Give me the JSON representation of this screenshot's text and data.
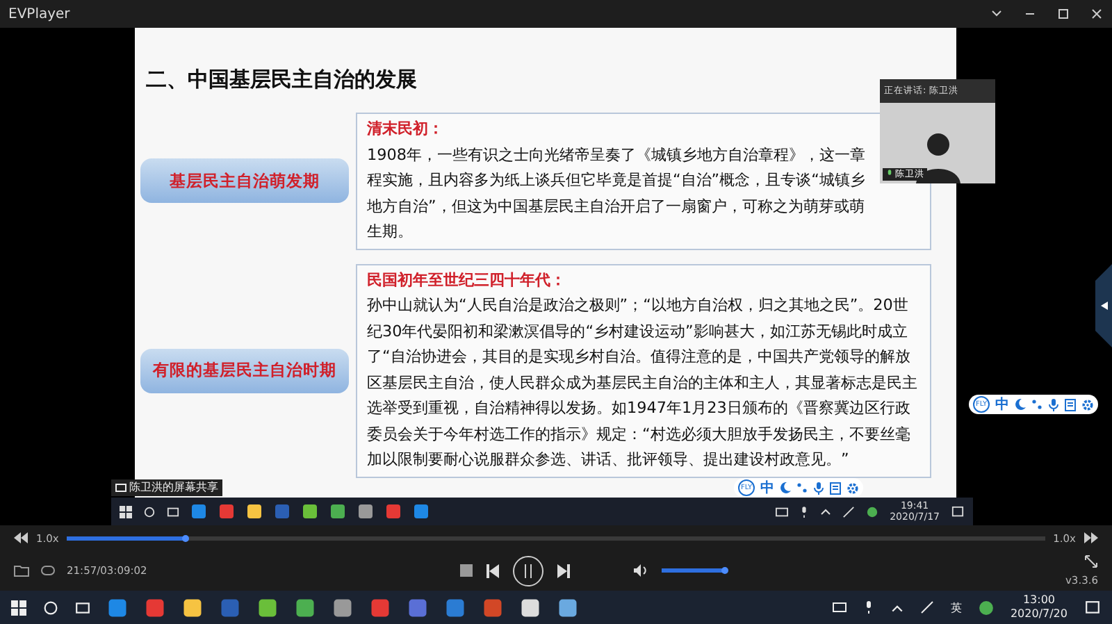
{
  "window": {
    "title": "EVPlayer"
  },
  "slide": {
    "title": "二、中国基层民主自治的发展",
    "sections": [
      {
        "label": "基层民主自治萌发期",
        "heading": "清末民初：",
        "body": "1908年，一些有识之士向光绪帝呈奏了《城镇乡地方自治章程》，这一章程实施，且内容多为纸上谈兵但它毕竟是首提“自治”概念，且专谈“城镇乡地方自治”，但这为中国基层民主自治开启了一扇窗户，可称之为萌芽或萌生期。"
      },
      {
        "label": "有限的基层民主自治时期",
        "heading": "民国初年至世纪三四十年代：",
        "body": "孙中山就认为“人民自治是政治之极则”；“以地方自治权，归之其地之民”。20世纪30年代晏阳初和梁漱溟倡导的“乡村建设运动”影响甚大，如江苏无锡此时成立了“自治协进会，其目的是实现乡村自治。值得注意的是，中国共产党领导的解放区基层民主自治，使人民群众成为基层民主自治的主体和主人，其显著标志是民主选举受到重视，自治精神得以发扬。如1947年1月23日颁布的《晋察冀边区行政委员会关于今年村选工作的指示》规定：“村选必须大胆放手发扬民主，不要丝毫加以限制要耐心说服群众参选、讲话、批评领导、提出建设村政意见。”"
      }
    ]
  },
  "speaker": {
    "header": "正在讲话: 陈卫洪",
    "name": "陈卫洪"
  },
  "screen_share_label": "陈卫洪的屏幕共享",
  "ime_toolbars": [
    {
      "badge": "FLY",
      "mode": "中"
    },
    {
      "badge": "FLY",
      "mode": "中"
    }
  ],
  "inner_taskbar": {
    "time": "19:41",
    "date": "2020/7/17"
  },
  "player": {
    "speed_left": "1.0x",
    "speed_right": "1.0x",
    "progress": {
      "level": 0.12
    },
    "time": "21:57/03:09:02",
    "volume": {
      "level": 1
    },
    "version": "v3.3.6"
  },
  "taskbar": {
    "input_language": "英",
    "time": "13:00",
    "date": "2020/7/20"
  }
}
